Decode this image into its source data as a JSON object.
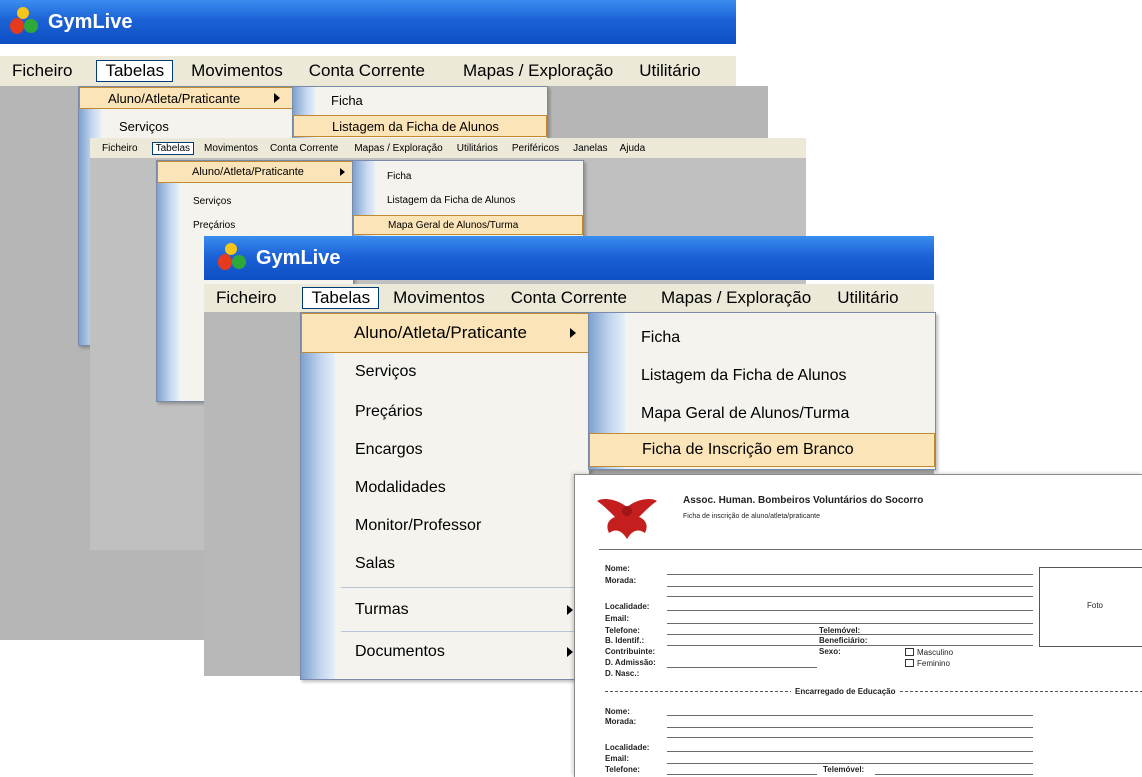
{
  "app_title": "GymLive",
  "menubar": {
    "items": [
      "Ficheiro",
      "Tabelas",
      "Movimentos",
      "Conta Corrente",
      "Mapas / Exploração",
      "Utilitário"
    ],
    "items_full": [
      "Ficheiro",
      "Tabelas",
      "Movimentos",
      "Conta Corrente",
      "Mapas / Exploração",
      "Utilitários",
      "Periféricos",
      "Janelas",
      "Ajuda"
    ]
  },
  "tabelas_menu": {
    "items": [
      "Aluno/Atleta/Praticante",
      "Serviços",
      "Preçários",
      "Encargos",
      "Modalidades",
      "Monitor/Professor",
      "Salas",
      "Turmas",
      "Documentos"
    ]
  },
  "aluno_submenu": {
    "items": [
      "Ficha",
      "Listagem da Ficha de Alunos",
      "Mapa Geral de Alunos/Turma",
      "Ficha de Inscrição em Branco"
    ]
  },
  "form": {
    "org": "Assoc. Human. Bombeiros Voluntários do Socorro",
    "subtitle": "Ficha de inscrição de aluno/atleta/praticante",
    "labels": {
      "nome": "Nome:",
      "morada": "Morada:",
      "localidade": "Localidade:",
      "email": "Email:",
      "telefone": "Telefone:",
      "bi": "B. Identif.:",
      "contribuinte": "Contribuinte:",
      "admissao": "D. Admissão:",
      "nasc": "D. Nasc.:",
      "telemovel": "Telemóvel:",
      "beneficiario": "Beneficiário:",
      "sexo": "Sexo:",
      "masculino": "Masculino",
      "feminino": "Feminino",
      "foto": "Foto",
      "encarregado": "Encarregado de Educação"
    }
  }
}
